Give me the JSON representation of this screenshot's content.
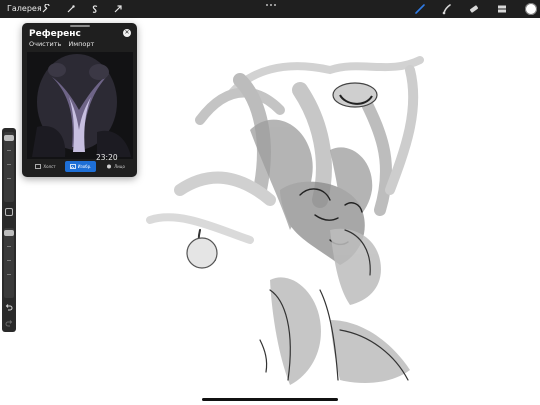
{
  "topbar": {
    "gallery_label": "Галерея",
    "tools_left": [
      {
        "icon": "wrench-icon"
      },
      {
        "icon": "magic-wand-icon"
      },
      {
        "icon": "selection-s-icon"
      },
      {
        "icon": "arrow-cursor-icon"
      }
    ],
    "tools_right": [
      {
        "icon": "brush-icon",
        "color": "#2f7be5"
      },
      {
        "icon": "smudge-icon",
        "color": "#d8d8d8"
      },
      {
        "icon": "eraser-icon",
        "color": "#d8d8d8"
      },
      {
        "icon": "layers-icon",
        "color": "#d8d8d8"
      }
    ],
    "color_swatch": "#ffffff"
  },
  "sidebar": {
    "brush_size_level": 0.82,
    "opacity_level": 0.58
  },
  "reference_panel": {
    "title": "Референс",
    "actions": [
      "Очистить",
      "Импорт"
    ],
    "time": "23:20",
    "tabs": [
      {
        "label": "Холст",
        "icon": "canvas-icon",
        "active": false
      },
      {
        "label": "Изобр.",
        "icon": "image-icon",
        "active": true
      },
      {
        "label": "Лицо",
        "icon": "face-icon",
        "active": false
      }
    ],
    "accent": "#1e6fd6"
  }
}
